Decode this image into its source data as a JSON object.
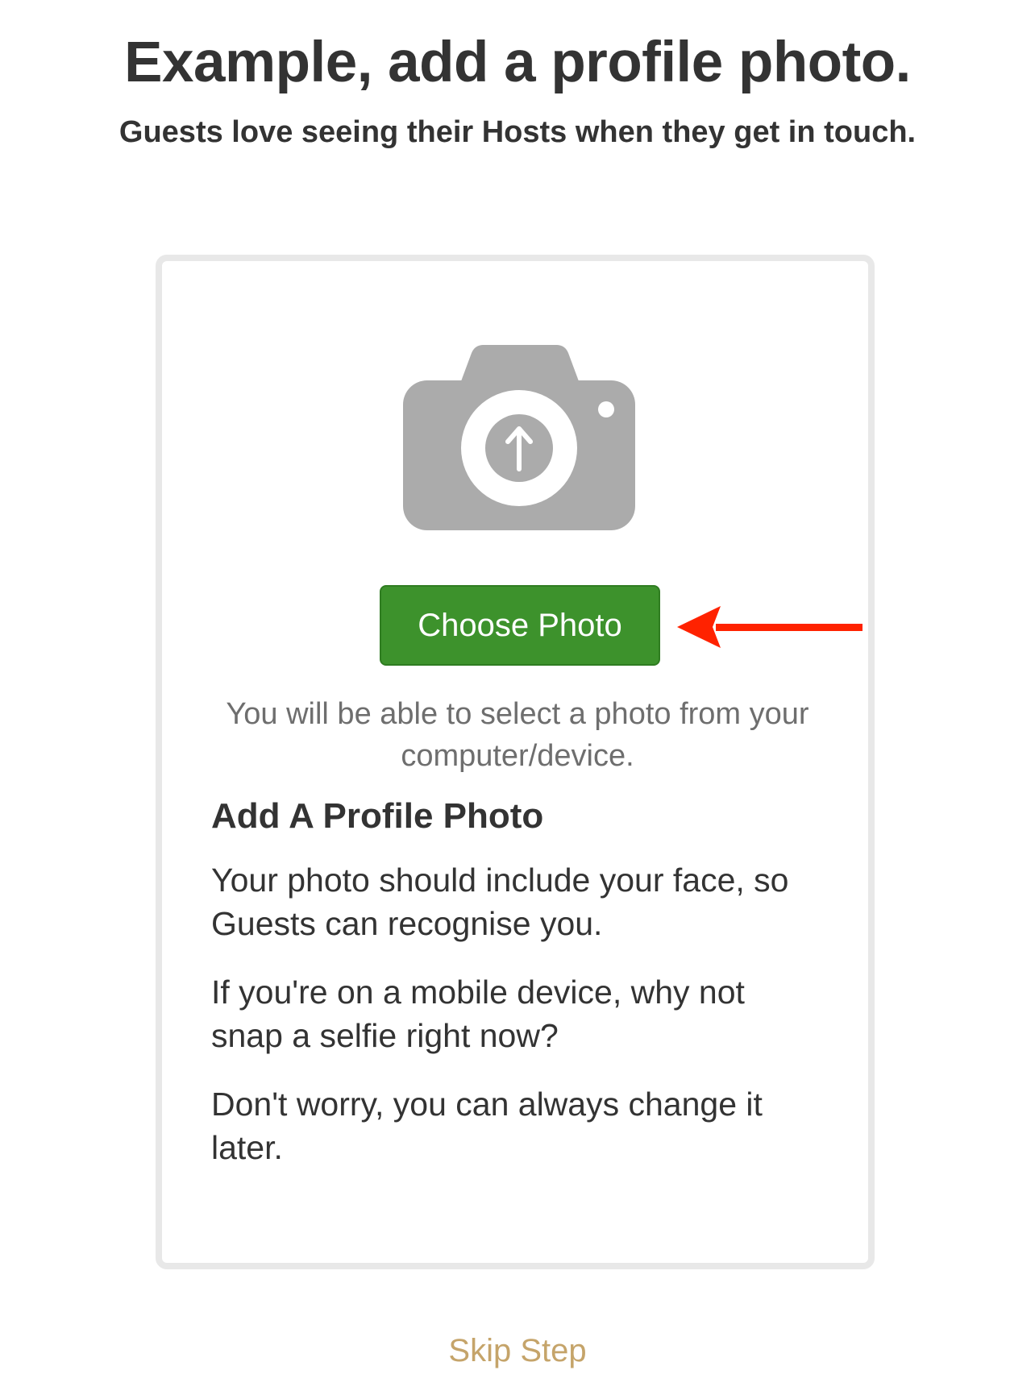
{
  "header": {
    "title": "Example, add a profile photo.",
    "subtitle": "Guests love seeing their Hosts when they get in touch."
  },
  "upload_card": {
    "camera_icon": "camera-upload-icon",
    "choose_button_label": "Choose Photo",
    "annotation_arrow": "red-arrow-pointing-left",
    "helper_text": "You will be able to select a photo from your computer/device.",
    "section_heading": "Add A Profile Photo",
    "paragraphs": [
      "Your photo should include your face, so Guests can recognise you.",
      "If you're on a mobile device, why not snap a selfie right now?",
      "Don't worry, you can always change it later."
    ]
  },
  "footer": {
    "skip_label": "Skip Step"
  },
  "colors": {
    "button_green": "#3d922c",
    "skip_gold": "#c5a46a",
    "arrow_red": "#ff2200",
    "camera_gray": "#ababab"
  }
}
